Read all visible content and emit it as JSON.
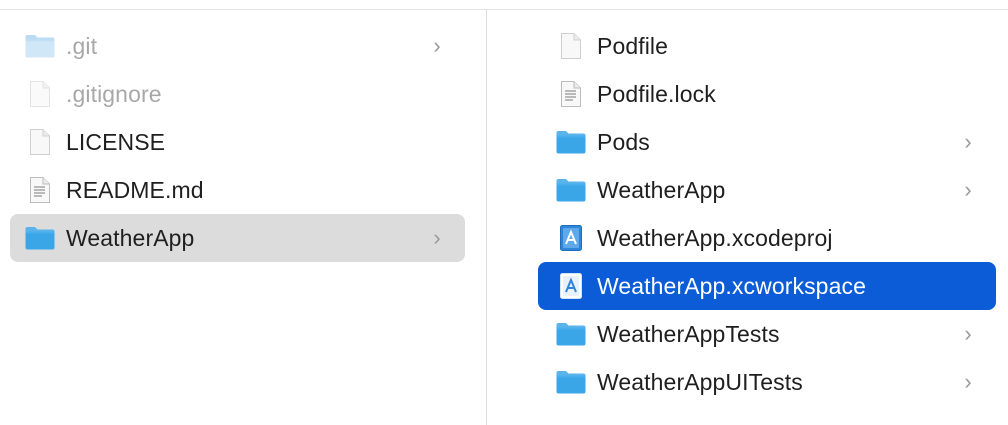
{
  "window": {
    "columns": [
      {
        "items": [
          {
            "name": ".git",
            "icon": "folder-icon",
            "has_children": true,
            "dimmed": true,
            "state": "normal"
          },
          {
            "name": ".gitignore",
            "icon": "document-icon",
            "has_children": false,
            "dimmed": true,
            "state": "normal"
          },
          {
            "name": "LICENSE",
            "icon": "document-icon",
            "has_children": false,
            "dimmed": false,
            "state": "normal"
          },
          {
            "name": "README.md",
            "icon": "text-document-icon",
            "has_children": false,
            "dimmed": false,
            "state": "normal"
          },
          {
            "name": "WeatherApp",
            "icon": "folder-icon",
            "has_children": true,
            "dimmed": false,
            "state": "selected-inactive"
          }
        ]
      },
      {
        "items": [
          {
            "name": "Podfile",
            "icon": "document-icon",
            "has_children": false,
            "state": "normal"
          },
          {
            "name": "Podfile.lock",
            "icon": "text-document-icon",
            "has_children": false,
            "state": "normal"
          },
          {
            "name": "Pods",
            "icon": "folder-icon",
            "has_children": true,
            "state": "normal"
          },
          {
            "name": "WeatherApp",
            "icon": "folder-icon",
            "has_children": true,
            "state": "normal"
          },
          {
            "name": "WeatherApp.xcodeproj",
            "icon": "xcode-project-icon",
            "has_children": false,
            "state": "normal"
          },
          {
            "name": "WeatherApp.xcworkspace",
            "icon": "xcode-workspace-icon",
            "has_children": false,
            "state": "selected-active"
          },
          {
            "name": "WeatherAppTests",
            "icon": "folder-icon",
            "has_children": true,
            "state": "normal"
          },
          {
            "name": "WeatherAppUITests",
            "icon": "folder-icon",
            "has_children": true,
            "state": "normal"
          }
        ]
      }
    ],
    "chevron_glyph": "›",
    "colors": {
      "selection_active": "#0b5cd6",
      "selection_inactive": "#dcdcdc",
      "folder_blue": "#3aa6e8",
      "text": "#1f1f1f",
      "text_dimmed": "#a8a8a8"
    }
  }
}
